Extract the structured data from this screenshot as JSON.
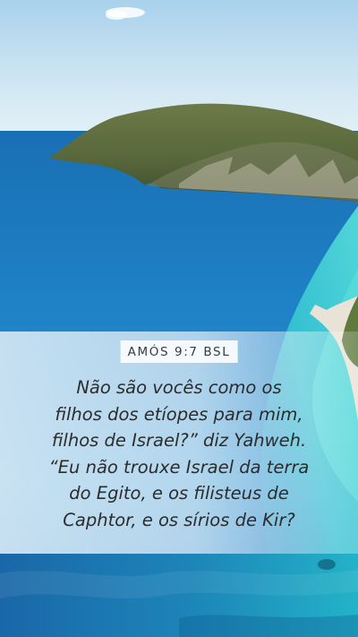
{
  "verse": {
    "reference": "AMÓS 9:7 BSL",
    "lines": [
      "Não são vocês como os",
      "filhos dos etíopes para mim,",
      "filhos de Israel?” diz Yahweh.",
      "“Eu não trouxe Israel da terra",
      "do Egito, e os filisteus de",
      "Caphtor, e os sírios de Kir?"
    ]
  },
  "colors": {
    "sky": "#cfe6f3",
    "deep_sea": "#1d78bf",
    "turquoise": "#3fd0d4",
    "headland": "#5d6d40",
    "reference_text": "#3a3a3a",
    "verse_text": "#2c2c2c"
  }
}
